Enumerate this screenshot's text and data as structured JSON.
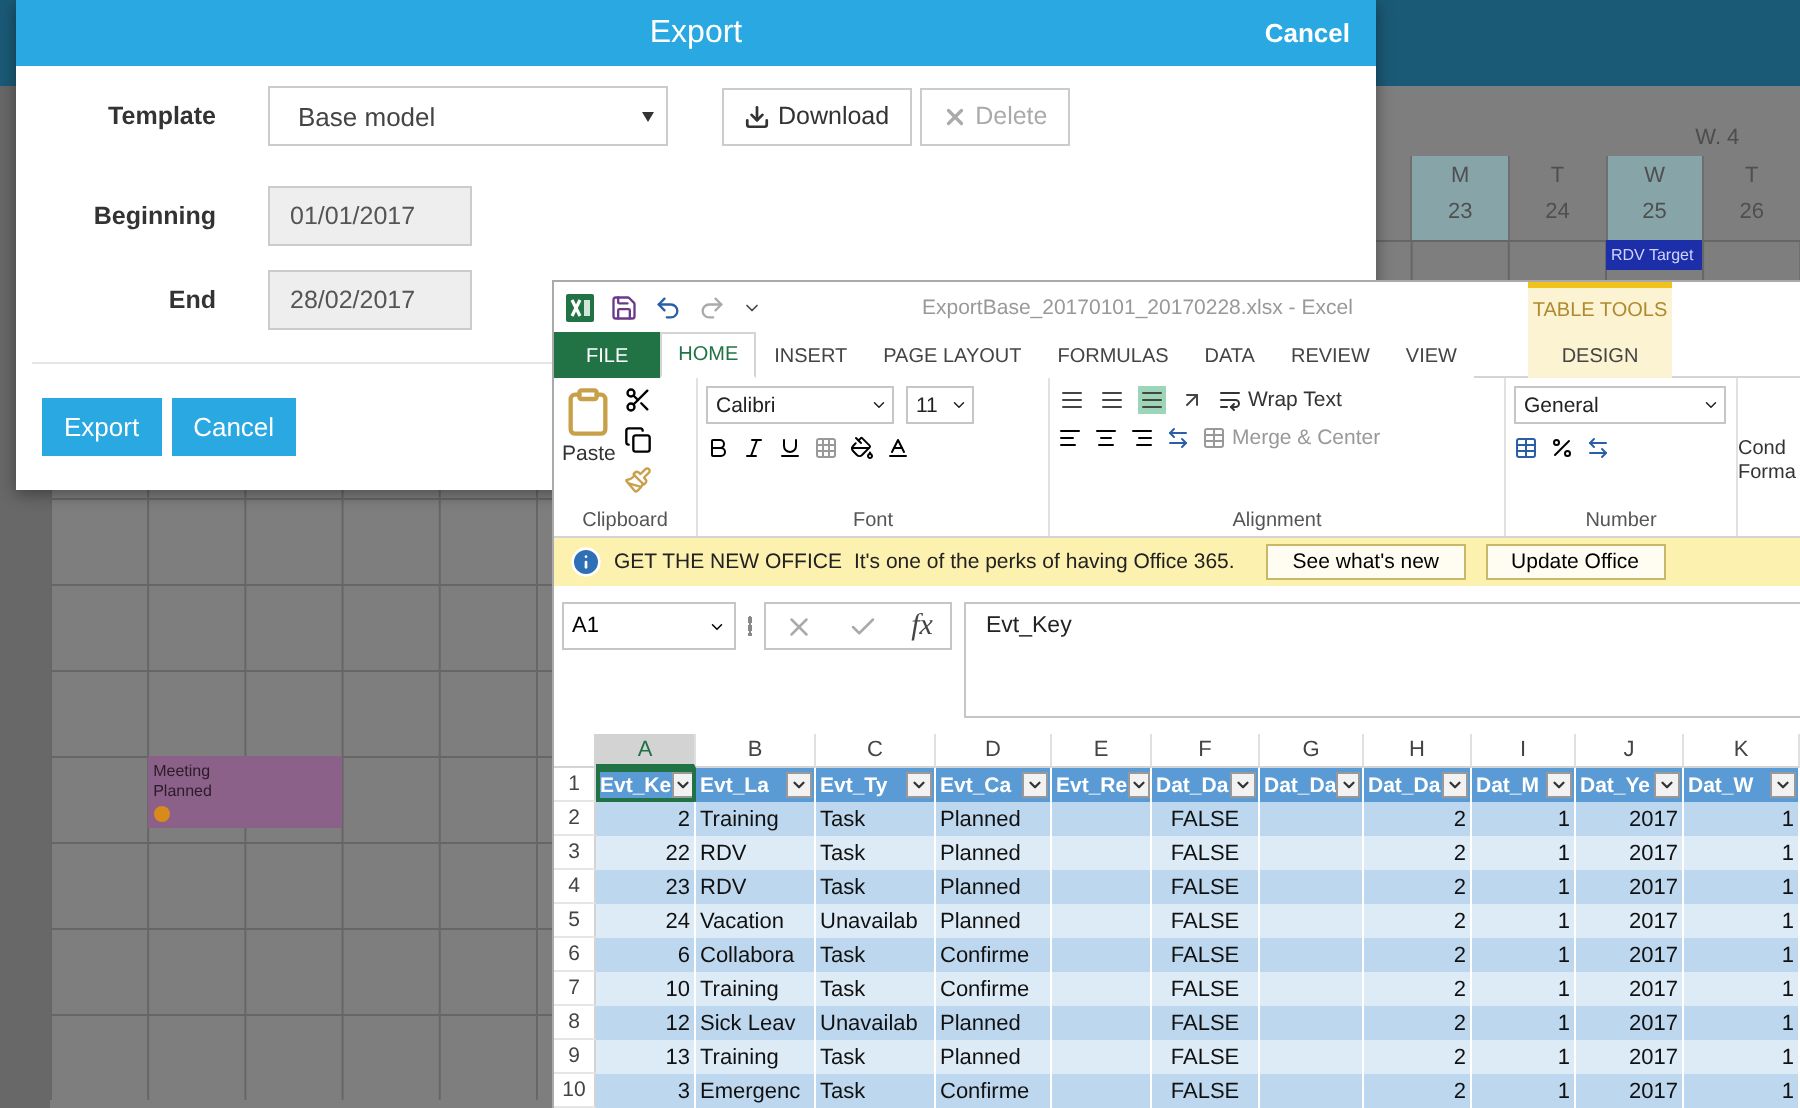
{
  "calendar": {
    "week_label": "W. 4",
    "days": [
      {
        "weekday": "M",
        "date": "23",
        "highlighted": true
      },
      {
        "weekday": "T",
        "date": "24",
        "highlighted": false
      },
      {
        "weekday": "W",
        "date": "25",
        "highlighted": true
      },
      {
        "weekday": "T",
        "date": "26",
        "highlighted": false
      }
    ],
    "events": [
      {
        "lines": [
          "Meeting",
          "Planned"
        ],
        "color": "#8c6189",
        "badge": true
      },
      {
        "lines": [
          "RDV Target"
        ],
        "color": "#1c2ea8",
        "badge": false
      }
    ]
  },
  "export_dialog": {
    "title": "Export",
    "header_action": "Cancel",
    "fields": [
      {
        "label": "Template",
        "kind": "select",
        "value": "Base model"
      },
      {
        "label": "Beginning",
        "kind": "date",
        "value": "01/01/2017"
      },
      {
        "label": "End",
        "kind": "date",
        "value": "28/02/2017"
      }
    ],
    "template_buttons": [
      {
        "label": "Download",
        "disabled": false
      },
      {
        "label": "Delete",
        "disabled": true
      }
    ],
    "footer_buttons": [
      "Export",
      "Cancel"
    ]
  },
  "excel": {
    "title": "ExportBase_20170101_20170228.xlsx - Excel",
    "contextual_label": "TABLE TOOLS",
    "tabs": [
      {
        "label": "FILE",
        "kind": "file",
        "selected": false
      },
      {
        "label": "HOME",
        "kind": "normal",
        "selected": true
      },
      {
        "label": "INSERT",
        "kind": "normal",
        "selected": false
      },
      {
        "label": "PAGE LAYOUT",
        "kind": "normal",
        "selected": false
      },
      {
        "label": "FORMULAS",
        "kind": "normal",
        "selected": false
      },
      {
        "label": "DATA",
        "kind": "normal",
        "selected": false
      },
      {
        "label": "REVIEW",
        "kind": "normal",
        "selected": false
      },
      {
        "label": "VIEW",
        "kind": "normal",
        "selected": false
      },
      {
        "label": "DESIGN",
        "kind": "contextual",
        "selected": false
      }
    ],
    "ribbon": {
      "paste_label": "Paste",
      "font_name": "Calibri",
      "font_size": "11",
      "wrap_text": "Wrap Text",
      "merge": "Merge & Center",
      "number_format": "General",
      "partial_command": "Cond Forma",
      "groups": [
        "Clipboard",
        "Font",
        "Alignment",
        "Number"
      ]
    },
    "message_bar": {
      "title": "GET THE NEW OFFICE",
      "text": "It's one of the perks of having Office 365.",
      "buttons": [
        "See what's new",
        "Update Office"
      ]
    },
    "name_box": "A1",
    "function_label": "fx",
    "formula": "Evt_Key",
    "columns": [
      {
        "letter": "A",
        "selected": true
      },
      {
        "letter": "B",
        "selected": false
      },
      {
        "letter": "C",
        "selected": false
      },
      {
        "letter": "D",
        "selected": false
      },
      {
        "letter": "E",
        "selected": false
      },
      {
        "letter": "F",
        "selected": false
      },
      {
        "letter": "G",
        "selected": false
      },
      {
        "letter": "H",
        "selected": false
      },
      {
        "letter": "I",
        "selected": false
      },
      {
        "letter": "J",
        "selected": false
      },
      {
        "letter": "K",
        "selected": false
      }
    ],
    "header_row": {
      "number": "1",
      "cells": [
        "Evt_Ke",
        "Evt_La",
        "Evt_Ty",
        "Evt_Ca",
        "Evt_Re",
        "Dat_Da",
        "Dat_Da",
        "Dat_Da",
        "Dat_M",
        "Dat_Ye",
        "Dat_W"
      ]
    },
    "rows": [
      {
        "number": "2",
        "cells": [
          "2",
          "Training",
          "Task",
          "Planned",
          "",
          "FALSE",
          "",
          "2",
          "1",
          "2017",
          "1"
        ]
      },
      {
        "number": "3",
        "cells": [
          "22",
          "RDV",
          "Task",
          "Planned",
          "",
          "FALSE",
          "",
          "2",
          "1",
          "2017",
          "1"
        ]
      },
      {
        "number": "4",
        "cells": [
          "23",
          "RDV",
          "Task",
          "Planned",
          "",
          "FALSE",
          "",
          "2",
          "1",
          "2017",
          "1"
        ]
      },
      {
        "number": "5",
        "cells": [
          "24",
          "Vacation",
          "Unavailab",
          "Planned",
          "",
          "FALSE",
          "",
          "2",
          "1",
          "2017",
          "1"
        ]
      },
      {
        "number": "6",
        "cells": [
          "6",
          "Collabora",
          "Task",
          "Confirme",
          "",
          "FALSE",
          "",
          "2",
          "1",
          "2017",
          "1"
        ]
      },
      {
        "number": "7",
        "cells": [
          "10",
          "Training",
          "Task",
          "Confirme",
          "",
          "FALSE",
          "",
          "2",
          "1",
          "2017",
          "1"
        ]
      },
      {
        "number": "8",
        "cells": [
          "12",
          "Sick Leav",
          "Unavailab",
          "Planned",
          "",
          "FALSE",
          "",
          "2",
          "1",
          "2017",
          "1"
        ]
      },
      {
        "number": "9",
        "cells": [
          "13",
          "Training",
          "Task",
          "Planned",
          "",
          "FALSE",
          "",
          "2",
          "1",
          "2017",
          "1"
        ]
      },
      {
        "number": "10",
        "cells": [
          "3",
          "Emergenc",
          "Task",
          "Confirme",
          "",
          "FALSE",
          "",
          "2",
          "1",
          "2017",
          "1"
        ]
      }
    ]
  }
}
